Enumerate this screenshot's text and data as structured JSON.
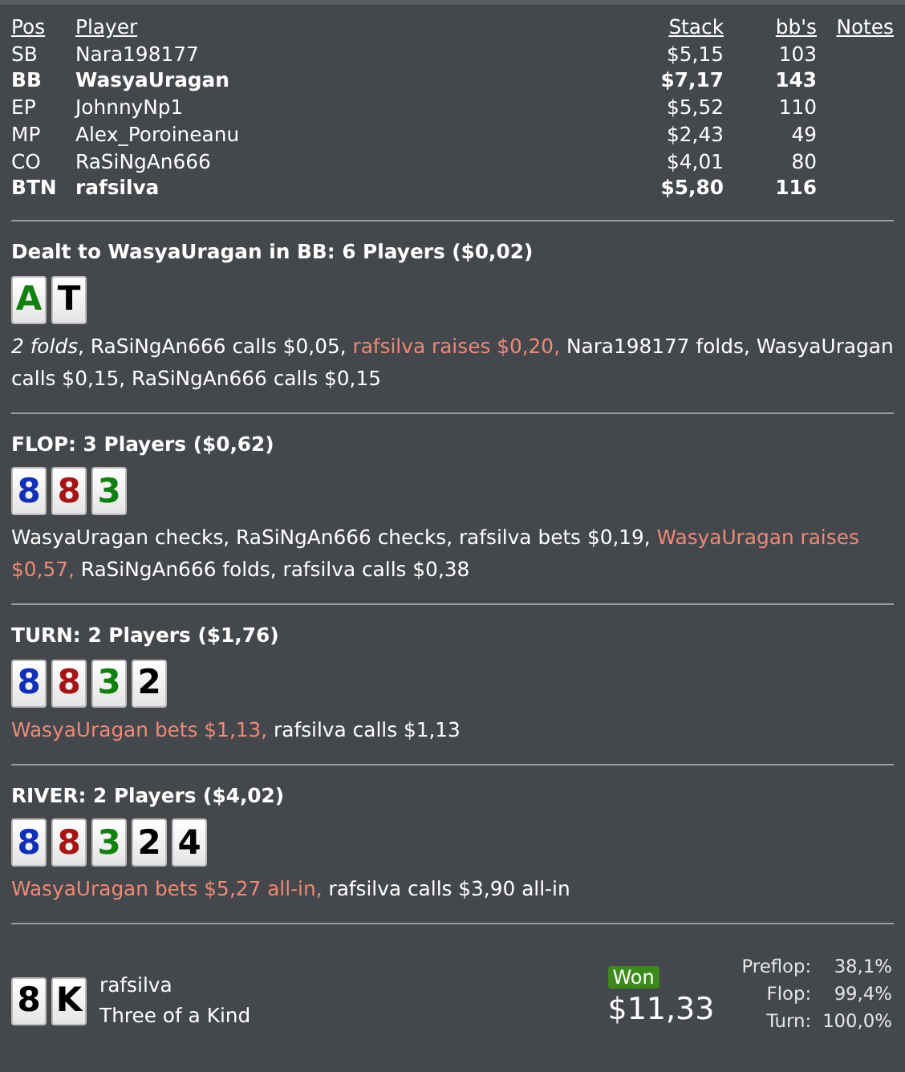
{
  "players": {
    "columns": [
      "Pos",
      "Player",
      "Stack",
      "bb's",
      "Notes"
    ],
    "rows": [
      {
        "pos": "SB",
        "player": "Nara198177",
        "stack": "$5,15",
        "bbs": "103",
        "highlighted": false
      },
      {
        "pos": "BB",
        "player": "WasyaUragan",
        "stack": "$7,17",
        "bbs": "143",
        "highlighted": true
      },
      {
        "pos": "EP",
        "player": "JohnnyNp1",
        "stack": "$5,52",
        "bbs": "110",
        "highlighted": false
      },
      {
        "pos": "MP",
        "player": "Alex_Poroineanu",
        "stack": "$2,43",
        "bbs": "49",
        "highlighted": false
      },
      {
        "pos": "CO",
        "player": "RaSiNgAn666",
        "stack": "$4,01",
        "bbs": "80",
        "highlighted": false
      },
      {
        "pos": "BTN",
        "player": "rafsilva",
        "stack": "$5,80",
        "bbs": "116",
        "highlighted": true
      }
    ]
  },
  "streets": [
    {
      "title": "Dealt to WasyaUragan in BB: 6 Players ($0,02)",
      "cards": [
        {
          "rank": "A",
          "color": "#118011"
        },
        {
          "rank": "T",
          "color": "#000000"
        }
      ],
      "actions": [
        {
          "text": "*2 folds*, RaSiNgAn666 calls $0,05, ",
          "highlight": false
        },
        {
          "text": "rafsilva raises $0,20,",
          "highlight": true
        },
        {
          "text": " Nara198177 folds, WasyaUragan calls $0,15, RaSiNgAn666 calls $0,15",
          "highlight": false
        }
      ]
    },
    {
      "title": "FLOP: 3 Players ($0,62)",
      "cards": [
        {
          "rank": "8",
          "color": "#1030b8"
        },
        {
          "rank": "8",
          "color": "#a51515"
        },
        {
          "rank": "3",
          "color": "#118011"
        }
      ],
      "actions": [
        {
          "text": "WasyaUragan checks, RaSiNgAn666 checks, rafsilva bets $0,19, ",
          "highlight": false
        },
        {
          "text": "WasyaUragan raises $0,57,",
          "highlight": true
        },
        {
          "text": " RaSiNgAn666 folds, rafsilva calls $0,38",
          "highlight": false
        }
      ]
    },
    {
      "title": "TURN: 2 Players ($1,76)",
      "cards": [
        {
          "rank": "8",
          "color": "#1030b8"
        },
        {
          "rank": "8",
          "color": "#a51515"
        },
        {
          "rank": "3",
          "color": "#118011"
        },
        {
          "rank": "2",
          "color": "#000000"
        }
      ],
      "actions": [
        {
          "text": "WasyaUragan bets $1,13,",
          "highlight": true
        },
        {
          "text": " rafsilva calls $1,13",
          "highlight": false
        }
      ]
    },
    {
      "title": "RIVER: 2 Players ($4,02)",
      "cards": [
        {
          "rank": "8",
          "color": "#1030b8"
        },
        {
          "rank": "8",
          "color": "#a51515"
        },
        {
          "rank": "3",
          "color": "#118011"
        },
        {
          "rank": "2",
          "color": "#000000"
        },
        {
          "rank": "4",
          "color": "#000000"
        }
      ],
      "actions": [
        {
          "text": "WasyaUragan bets $5,27 all-in,",
          "highlight": true
        },
        {
          "text": " rafsilva calls $3,90 all-in",
          "highlight": false
        }
      ]
    }
  ],
  "result": {
    "cards": [
      {
        "rank": "8",
        "color": "#000000"
      },
      {
        "rank": "K",
        "color": "#000000"
      }
    ],
    "player": "rafsilva",
    "hand": "Three of a Kind",
    "badge": "Won",
    "amount": "$11,33",
    "equity": [
      {
        "label": "Preflop:",
        "value": "38,1%"
      },
      {
        "label": "Flop:",
        "value": "99,4%"
      },
      {
        "label": "Turn:",
        "value": "100,0%"
      }
    ]
  }
}
